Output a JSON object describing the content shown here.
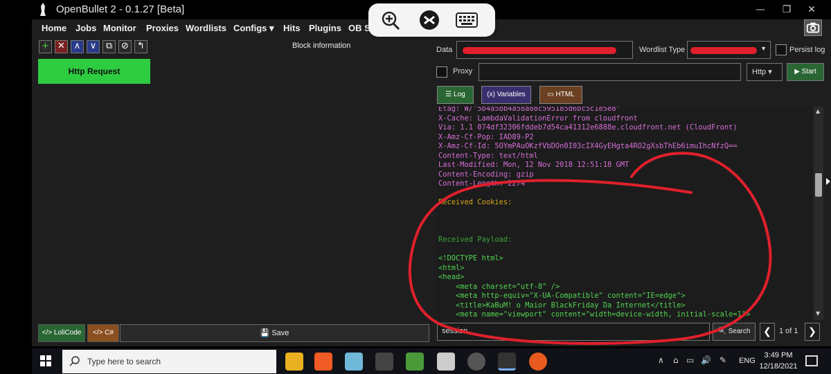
{
  "window": {
    "title": "OpenBullet 2 - 0.1.27 [Beta]",
    "min_glyph": "—",
    "max_glyph": "❐",
    "close_glyph": "✕"
  },
  "menu": [
    "Home",
    "Jobs",
    "Monitor",
    "Proxies",
    "Wordlists",
    "Configs ▾",
    "Hits",
    "Plugins",
    "OB S"
  ],
  "left": {
    "toolbar": [
      "+",
      "✕",
      "∧",
      "∨",
      "⧉",
      "⊘",
      "↰"
    ],
    "block_info_title": "Block information",
    "blocks": [
      {
        "label": "Http Request"
      }
    ],
    "lolicode_label": "</> LoliCode",
    "csharp_label": "</> C#",
    "save_label": "💾  Save"
  },
  "right": {
    "data_label": "Data",
    "wordlist_type_label": "Wordlist Type",
    "persist_log_label": "Persist log",
    "proxy_label": "Proxy",
    "proxy_type": "Http ▾",
    "start_label": "▶ Start",
    "tabs": {
      "log": "☰ Log",
      "variables": "(x) Variables",
      "html": "▭ HTML"
    },
    "search_value": "session",
    "search_label": "🔍 Search",
    "page_info": "1 of 1",
    "prev": "❮",
    "next": "❯"
  },
  "log": [
    {
      "text": "Etag: W/\"5b4a5bb4a58a88c595185d6bc5c1e5e8\"",
      "color": "#d66fd6"
    },
    {
      "text": "X-Cache: LambdaValidationError from cloudfront",
      "color": "#d66fd6"
    },
    {
      "text": "Via: 1.1 074df32306fddeb7d54ca41312e6888e.cloudfront.net (CloudFront)",
      "color": "#d66fd6"
    },
    {
      "text": "X-Amz-Cf-Pop: IAD89-P2",
      "color": "#d66fd6"
    },
    {
      "text": "X-Amz-Cf-Id: 5OYmPAuOKzfVbDOn0I03cIX4GyEHgta4RO2gXsbThEb6imuIhcNfzQ==",
      "color": "#d66fd6"
    },
    {
      "text": "Content-Type: text/html",
      "color": "#d66fd6"
    },
    {
      "text": "Last-Modified: Mon, 12 Nov 2018 12:51:18 GMT",
      "color": "#d66fd6"
    },
    {
      "text": "Content-Encoding: gzip",
      "color": "#d66fd6"
    },
    {
      "text": "Content-Length: 2274",
      "color": "#d66fd6"
    },
    {
      "text": "",
      "color": "#ccc"
    },
    {
      "text": "Received Cookies:",
      "color": "#d9a31e"
    },
    {
      "text": "",
      "color": "#ccc"
    },
    {
      "text": "",
      "color": "#ccc"
    },
    {
      "text": "",
      "color": "#ccc"
    },
    {
      "text": "Received Payload:",
      "color": "#3aa63a"
    },
    {
      "text": "",
      "color": "#ccc"
    },
    {
      "text": "<!DOCTYPE html>",
      "color": "#52d452"
    },
    {
      "text": "<html>",
      "color": "#52d452"
    },
    {
      "text": "<head>",
      "color": "#52d452"
    },
    {
      "text": "    <meta charset=\"utf-8\" />",
      "color": "#52d452"
    },
    {
      "text": "    <meta http-equiv=\"X-UA-Compatible\" content=\"IE=edge\">",
      "color": "#52d452"
    },
    {
      "text": "    <title>KaBuM! o Maior BlackFriday Da Internet</title>",
      "color": "#52d452"
    },
    {
      "text": "    <meta name=\"viewport\" content=\"width=device-width, initial-scale=1\">",
      "color": "#52d452"
    }
  ],
  "taskbar": {
    "search_placeholder": "Type here to search",
    "lang": "ENG",
    "time": "3:49 PM",
    "date": "12/18/2021",
    "icons": [
      "file-explorer-icon",
      "brave-icon",
      "notepad-icon",
      "openbullet-icon",
      "editor-icon",
      "pwsh-icon",
      "circle-app-icon",
      "openbullet-active-icon",
      "firefox-icon"
    ]
  },
  "colors": {
    "accent_green": "#2ecc40",
    "annotation": "#e0202c"
  }
}
